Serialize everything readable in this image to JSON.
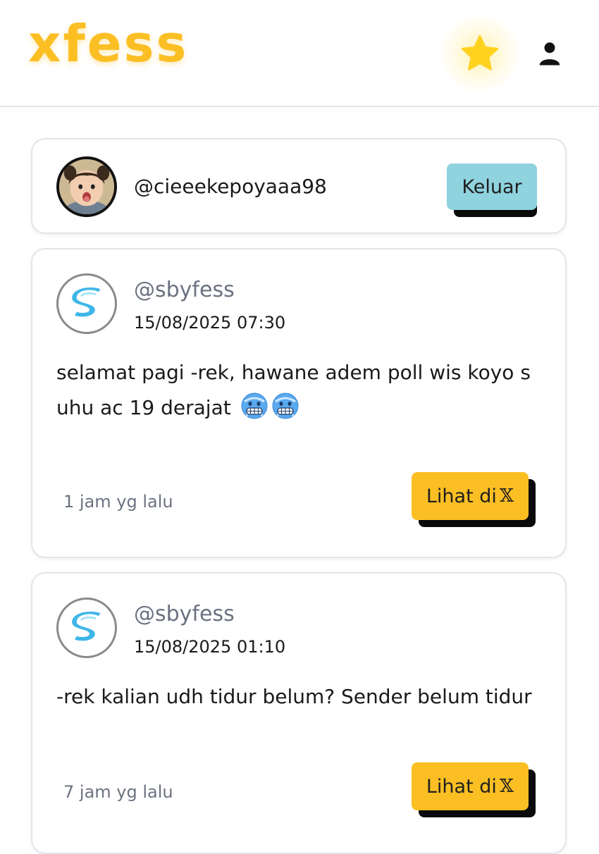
{
  "header": {
    "logo": "xfess",
    "favorites_icon": "star-icon",
    "account_icon": "user-icon",
    "accent_color": "#fbbf24"
  },
  "profile": {
    "avatar_icon": "user-avatar",
    "username": "@cieeekepoyaaa98",
    "logout_label": "Keluar",
    "logout_color": "#8fd3df"
  },
  "posts": [
    {
      "source_icon": "sbyfess-logo",
      "source": "@sbyfess",
      "date": "15/08/2025 07:30",
      "body": "selamat pagi -rek, hawane adem poll wis koyo suhu ac 19 derajat",
      "emojis": [
        "freezing-face-emoji",
        "freezing-face-emoji"
      ],
      "time_ago": "1 jam yg lalu",
      "view_label": "Lihat di",
      "view_platform_icon": "x-logo-icon"
    },
    {
      "source_icon": "sbyfess-logo",
      "source": "@sbyfess",
      "date": "15/08/2025 01:10",
      "body": "-rek kalian udh tidur belum? Sender belum tidur",
      "emojis": [],
      "time_ago": "7 jam yg lalu",
      "view_label": "Lihat di",
      "view_platform_icon": "x-logo-icon"
    }
  ],
  "view_button_color": "#fbbf24"
}
